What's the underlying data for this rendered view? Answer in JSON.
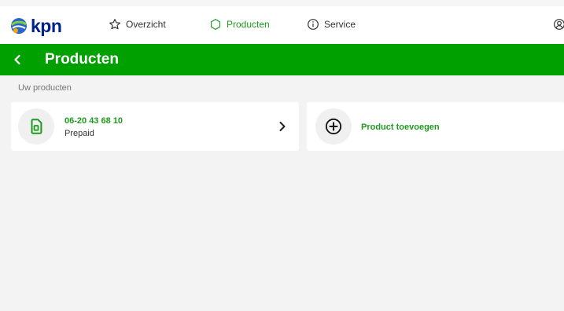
{
  "app": {
    "brand": "kpn"
  },
  "nav": {
    "items": [
      {
        "label": "Overzicht",
        "icon": "star-icon",
        "active": false
      },
      {
        "label": "Producten",
        "icon": "hexagon-icon",
        "active": true
      },
      {
        "label": "Service",
        "icon": "info-icon",
        "active": false
      }
    ]
  },
  "header": {
    "title": "Producten"
  },
  "section": {
    "label": "Uw producten"
  },
  "products": [
    {
      "number": "06-20 43 68 10",
      "type": "Prepaid",
      "icon": "sim-card-icon"
    }
  ],
  "add_product": {
    "label": "Product toevoegen",
    "icon": "plus-circle-icon"
  },
  "colors": {
    "brand_green": "#00a000",
    "text_green": "#1e9a1e",
    "brand_blue": "#00238a",
    "background": "#f3f3f3"
  }
}
